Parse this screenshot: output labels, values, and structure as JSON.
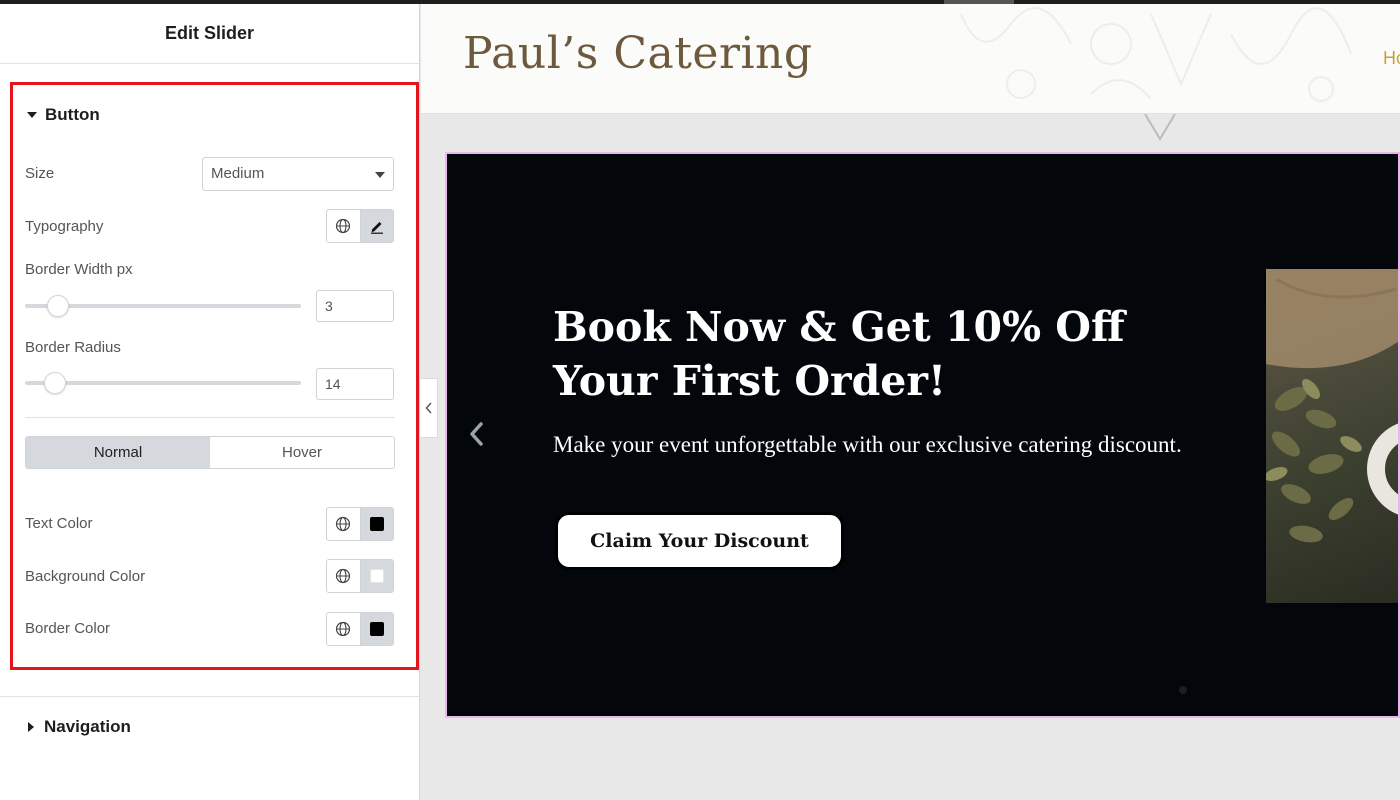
{
  "panel": {
    "header_title": "Edit Slider",
    "button_section": {
      "title": "Button",
      "size_label": "Size",
      "size_value": "Medium",
      "typography_label": "Typography",
      "border_width_label": "Border Width px",
      "border_width_value": "3",
      "border_width_fraction": 0.12,
      "border_radius_label": "Border Radius",
      "border_radius_value": "14",
      "border_radius_fraction": 0.11,
      "state_tabs": [
        "Normal",
        "Hover"
      ],
      "active_state": "Normal",
      "text_color_label": "Text Color",
      "text_color": "#000000",
      "background_color_label": "Background Color",
      "background_color": "#ffffff",
      "border_color_label": "Border Color",
      "border_color": "#000000"
    },
    "navigation_section": {
      "title": "Navigation"
    }
  },
  "preview": {
    "site_title": "Paul’s Catering",
    "nav_peek": "Ho",
    "slide": {
      "heading": "Book Now & Get 10% Off Your First Order!",
      "description": "Make your event unforgettable with our exclusive catering discount.",
      "cta_label": "Claim Your Discount"
    }
  },
  "colors": {
    "highlight_box": "#e3141b",
    "slider_bg": "#03070b",
    "site_title": "#6d5a3c",
    "nav_accent": "#c9a13b"
  },
  "icons": {
    "typography_global": "globe-icon",
    "typography_edit": "pencil-icon",
    "slide_prev": "chevron-left-icon",
    "collapse": "chevron-left-icon"
  }
}
